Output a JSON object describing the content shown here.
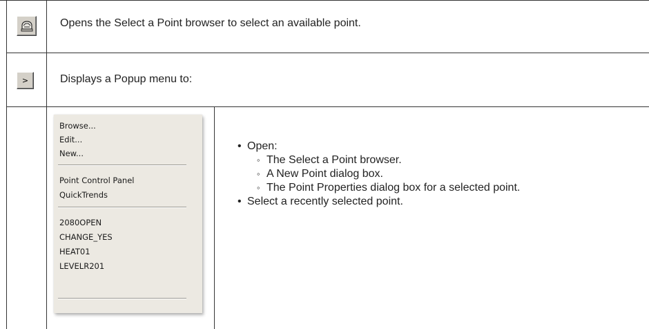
{
  "rows": [
    {
      "icon": "select-point-icon",
      "description": "Opens the Select a Point browser to select an available point."
    },
    {
      "icon": "chevron-right-icon",
      "button_glyph": ">",
      "description": "Displays a Popup menu to:"
    }
  ],
  "popup_menu": {
    "group1": [
      "Browse...",
      "Edit...",
      "New..."
    ],
    "group2": [
      "Point Control Panel",
      "QuickTrends"
    ],
    "group3": [
      "2080OPEN",
      "CHANGE_YES",
      "HEAT01",
      "LEVELR201"
    ]
  },
  "bullets": {
    "bullet_glyph": "•",
    "sub_glyph": "◦",
    "open_label": "Open:",
    "open_items": [
      "The Select a Point browser.",
      "A New Point dialog box.",
      "The Point Properties dialog box for a selected point."
    ],
    "select_label": "Select a recently selected point."
  }
}
